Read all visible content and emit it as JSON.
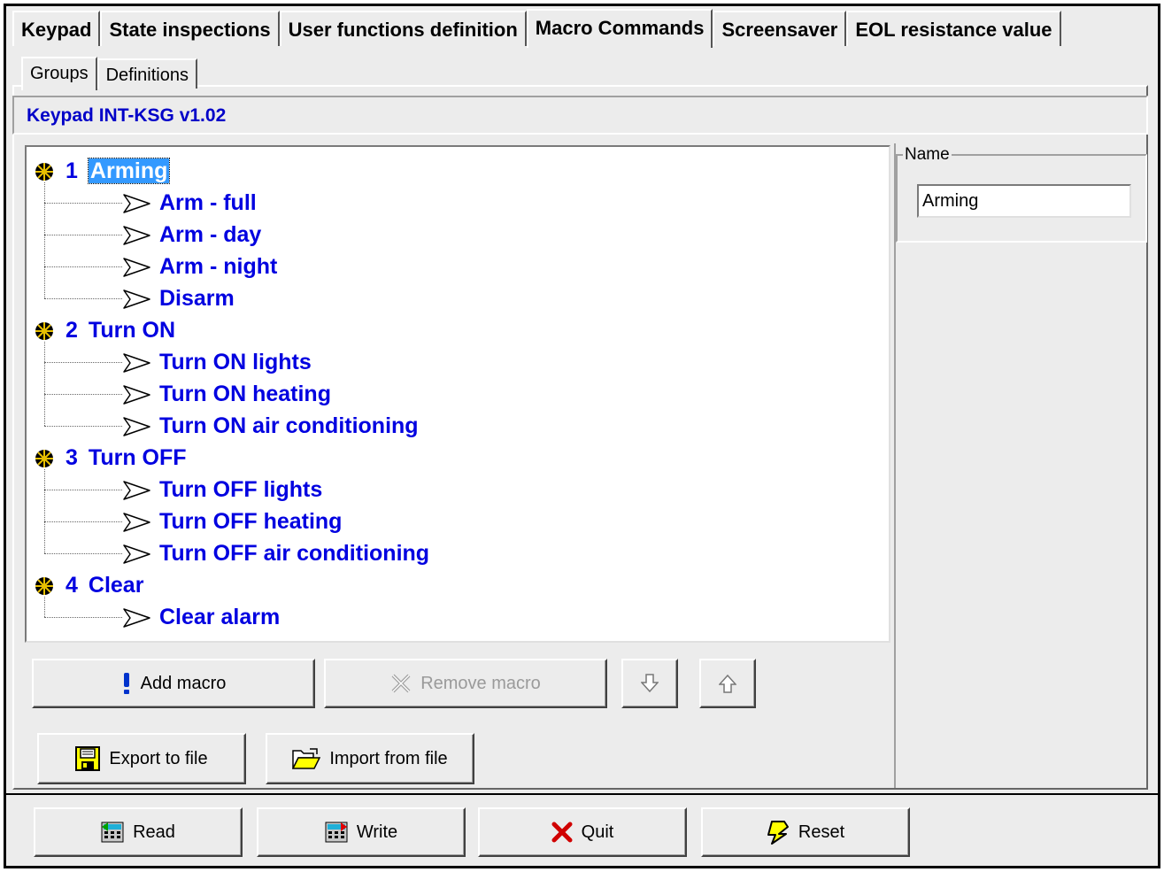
{
  "tabs": [
    "Keypad",
    "State inspections",
    "User functions definition",
    "Macro Commands",
    "Screensaver",
    "EOL resistance value"
  ],
  "active_tab": "Macro Commands",
  "subtabs": [
    "Groups",
    "Definitions"
  ],
  "active_subtab": "Groups",
  "header": {
    "title": "Keypad INT-KSG v1.02"
  },
  "tree": {
    "groups": [
      {
        "number": "1",
        "label": "Arming",
        "selected": true,
        "children": [
          "Arm - full",
          "Arm - day",
          "Arm - night",
          "Disarm"
        ]
      },
      {
        "number": "2",
        "label": "Turn ON",
        "selected": false,
        "children": [
          "Turn ON lights",
          "Turn ON heating",
          "Turn ON air conditioning"
        ]
      },
      {
        "number": "3",
        "label": "Turn OFF",
        "selected": false,
        "children": [
          "Turn OFF lights",
          "Turn OFF heating",
          "Turn OFF air conditioning"
        ]
      },
      {
        "number": "4",
        "label": "Clear",
        "selected": false,
        "children": [
          "Clear alarm"
        ]
      }
    ]
  },
  "name_panel": {
    "legend": "Name",
    "value": "Arming"
  },
  "buttons": {
    "add_macro": "Add macro",
    "remove_macro": "Remove macro",
    "export": "Export to file",
    "import": "Import from file"
  },
  "footer": {
    "read": "Read",
    "write": "Write",
    "quit": "Quit",
    "reset": "Reset"
  },
  "colors": {
    "node_text": "#0000e0",
    "selection": "#3399ff",
    "header_text": "#0000c8"
  }
}
